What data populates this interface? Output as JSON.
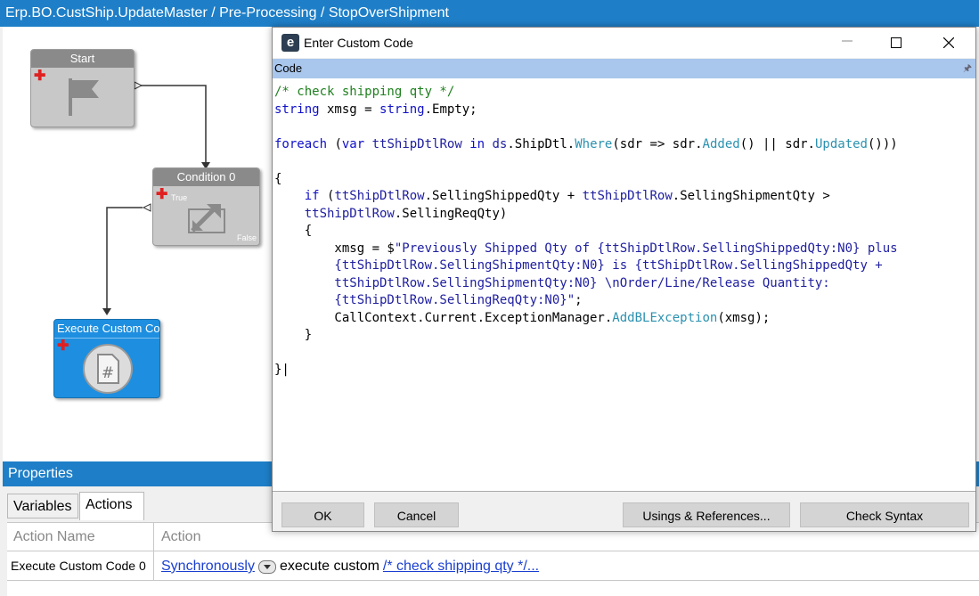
{
  "window": {
    "title": "Erp.BO.CustShip.UpdateMaster / Pre-Processing / StopOverShipment"
  },
  "workflow": {
    "start": {
      "label": "Start"
    },
    "condition": {
      "label": "Condition 0",
      "true_label": "True",
      "false_label": "False"
    },
    "execute": {
      "label": "Execute Custom Co"
    }
  },
  "properties": {
    "title": "Properties",
    "tabs": [
      {
        "label": "Variables"
      },
      {
        "label": "Actions"
      }
    ],
    "columns": [
      {
        "label": "Action Name"
      },
      {
        "label": "Action"
      }
    ],
    "rows": [
      {
        "name": "Execute Custom Code 0",
        "mode": "Synchronously",
        "middle": "execute custom",
        "code_link": "/* check shipping qty */..."
      }
    ]
  },
  "dialog": {
    "logo": "e",
    "title": "Enter Custom Code",
    "section": "Code",
    "code_lines": [
      "/* check shipping qty */",
      "string xmsg = string.Empty;",
      "",
      "foreach (var ttShipDtlRow in ds.ShipDtl.Where(sdr => sdr.Added() || sdr.Updated()))",
      "",
      "{",
      "    if (ttShipDtlRow.SellingShippedQty + ttShipDtlRow.SellingShipmentQty >",
      "    ttShipDtlRow.SellingReqQty)",
      "    {",
      "        xmsg = $\"Previously Shipped Qty of {ttShipDtlRow.SellingShippedQty:N0} plus",
      "        {ttShipDtlRow.SellingShipmentQty:N0} is {ttShipDtlRow.SellingShippedQty +",
      "        ttShipDtlRow.SellingShipmentQty:N0} \\nOrder/Line/Release Quantity:",
      "        {ttShipDtlRow.SellingReqQty:N0}\";",
      "        CallContext.Current.ExceptionManager.AddBLException(xmsg);",
      "    }",
      "",
      "}"
    ],
    "buttons": {
      "ok": "OK",
      "cancel": "Cancel",
      "usings": "Usings & References...",
      "check": "Check Syntax"
    }
  },
  "colors": {
    "accent": "#1e7fc8",
    "node_blue": "#1e8fe0",
    "node_gray": "#8a8a8a",
    "code_header": "#a9c6ec"
  },
  "icons": {
    "start": "flag-icon",
    "condition": "condition-arrows-icon",
    "execute": "custom-code-icon",
    "add": "plus-icon",
    "dropdown": "chevron-down-icon",
    "pin": "pin-icon"
  }
}
